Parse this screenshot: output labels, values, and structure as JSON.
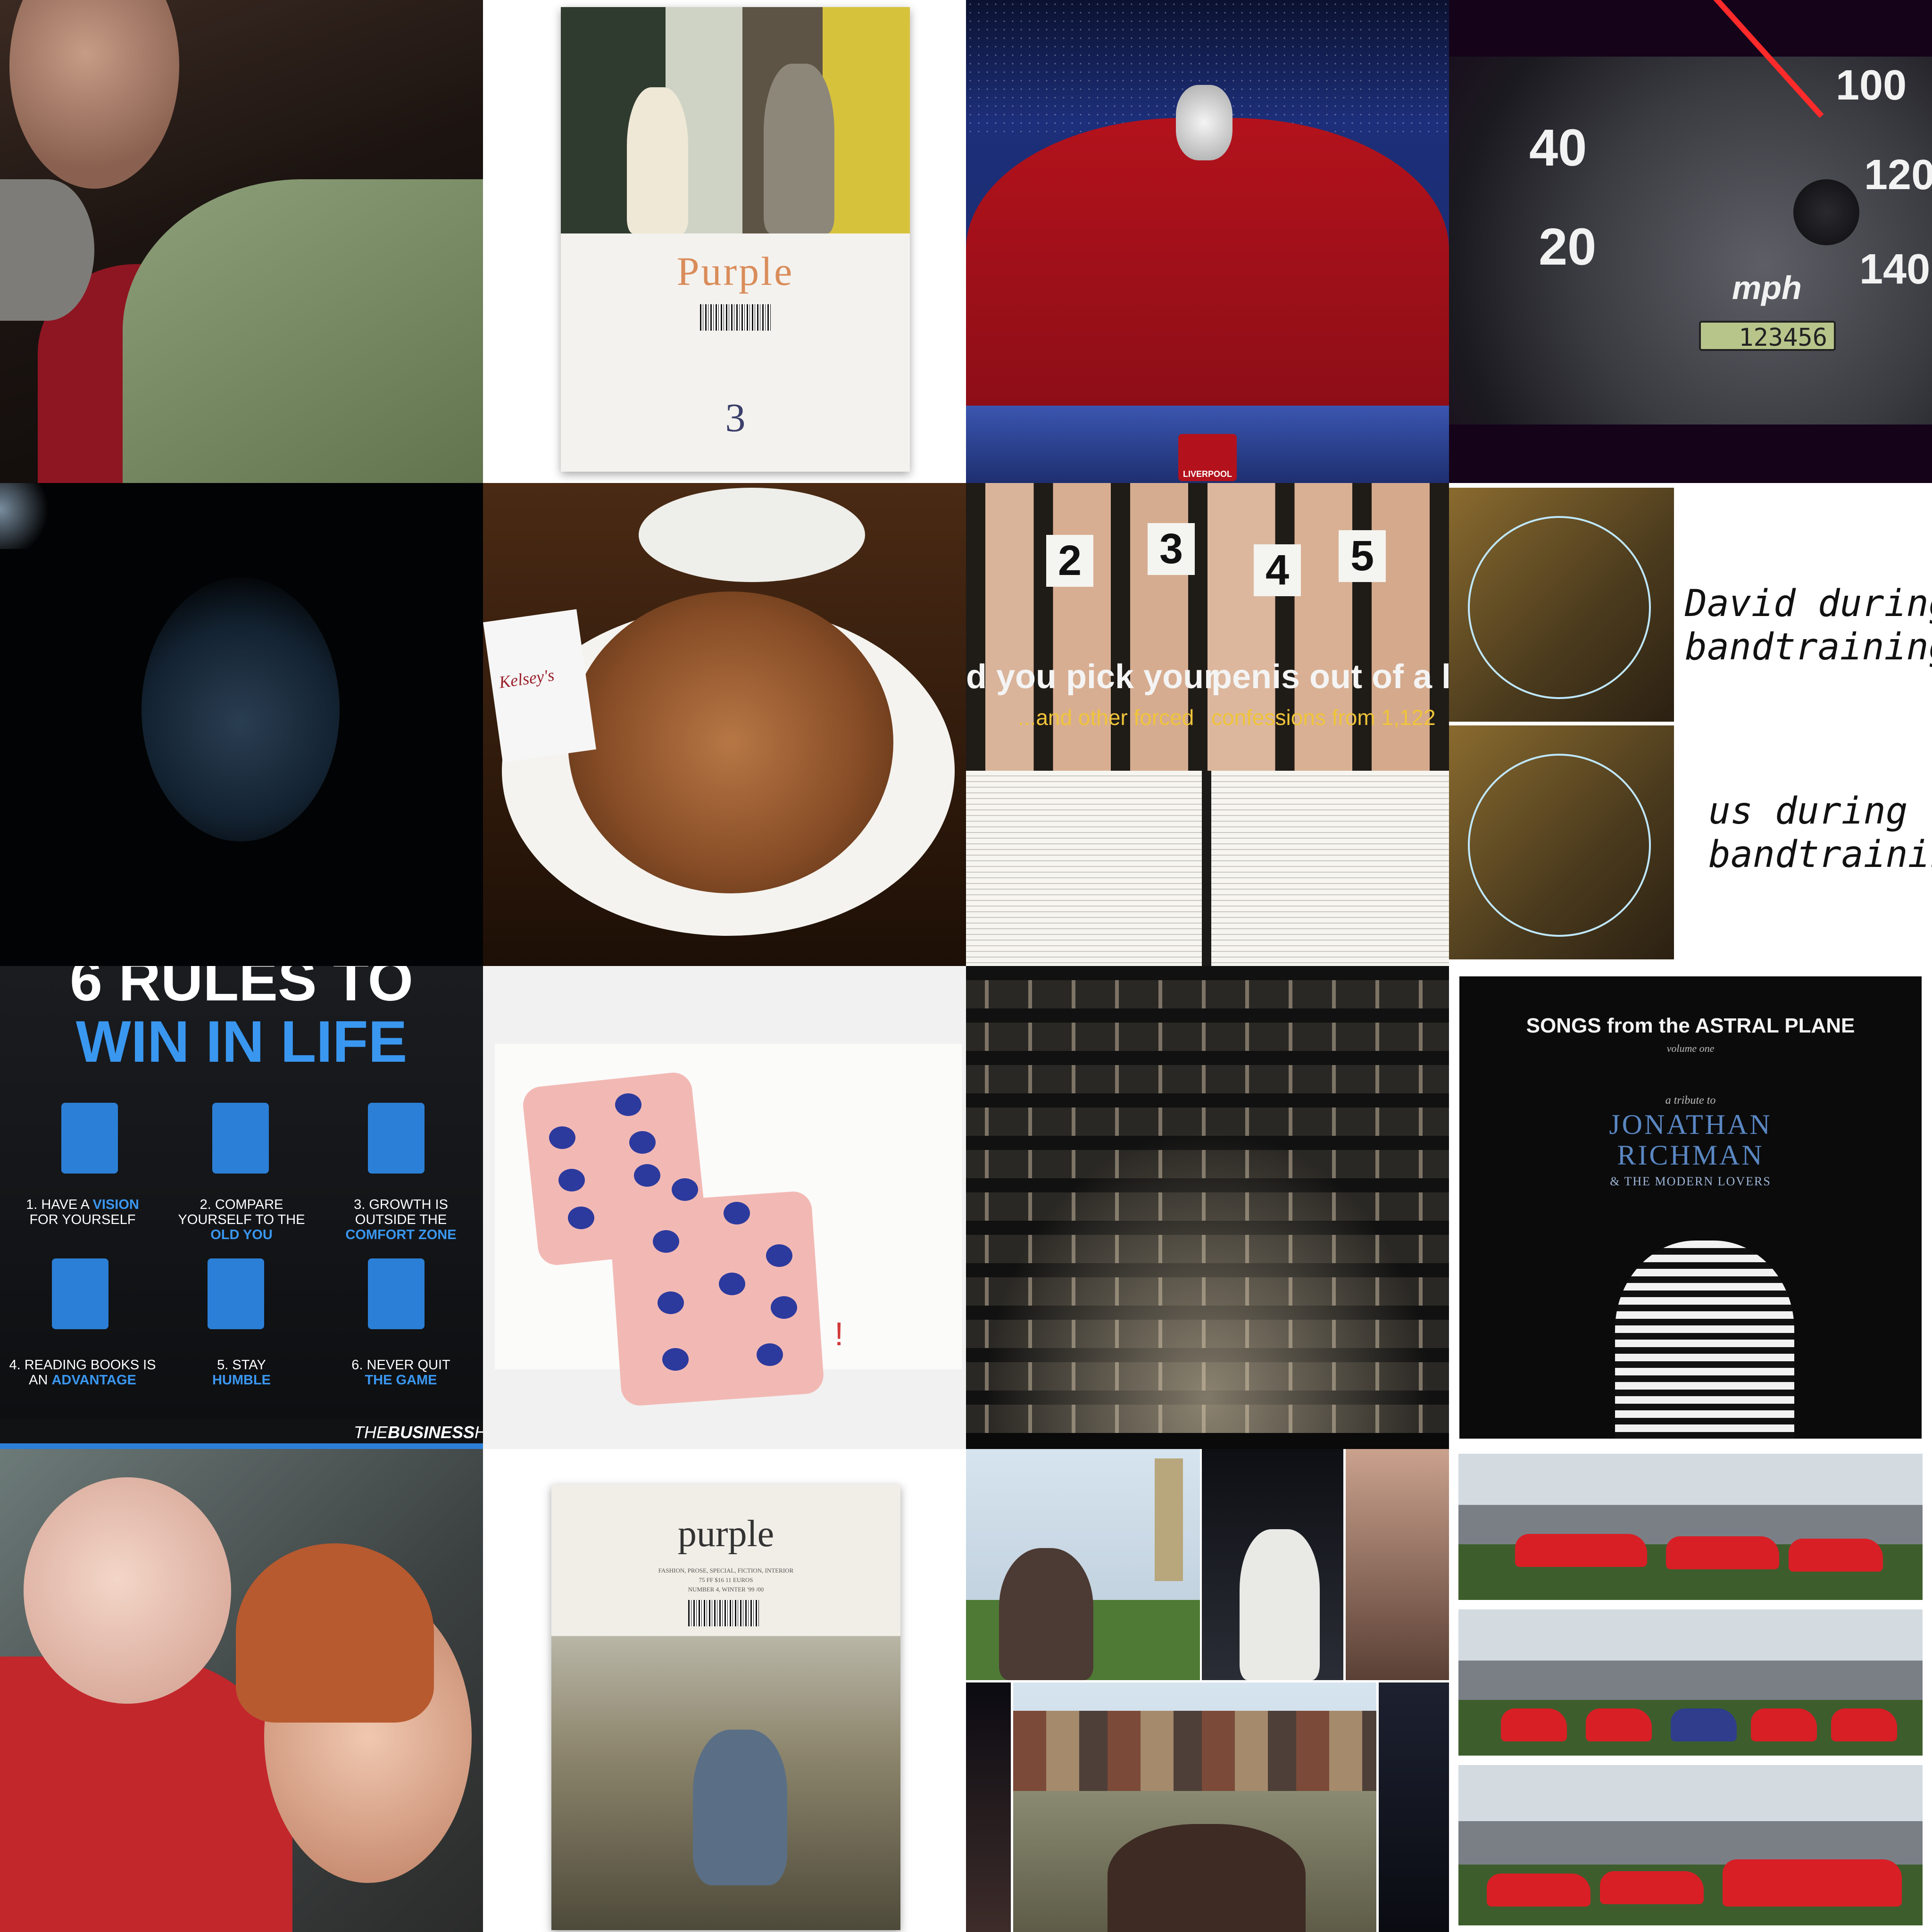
{
  "tiles": {
    "magazine_1": {
      "title": "Purple",
      "issue_number": "3"
    },
    "speedometer": {
      "speed_labels": [
        "20",
        "40",
        "100",
        "120",
        "140"
      ],
      "unit": "mph",
      "odometer": "123456"
    },
    "football": {
      "crest_text": "LIVERPOOL"
    },
    "wings": {
      "napkin_brand": "Kelsey's"
    },
    "confessions": {
      "numbers": [
        "2",
        "3",
        "4",
        "5"
      ],
      "headline_left": "d you pick your",
      "headline_right": "penis out of a li",
      "subhead_left": "...and other forced",
      "subhead_right": "confessions from 1,122"
    },
    "band": {
      "caption_1": [
        "David during",
        "bandtraining"
      ],
      "caption_2": [
        "us during",
        "bandtraining"
      ]
    },
    "rules": {
      "title_line_1": "6 RULES TO",
      "title_line_2": "WIN IN LIFE",
      "items": [
        {
          "num": "1.",
          "plain": "HAVE A",
          "highlight": "VISION",
          "rest": "FOR YOURSELF"
        },
        {
          "num": "2.",
          "plain": "COMPARE YOURSELF TO THE",
          "highlight": "OLD YOU",
          "rest": ""
        },
        {
          "num": "3.",
          "plain": "GROWTH IS OUTSIDE THE",
          "highlight": "COMFORT ZONE",
          "rest": ""
        },
        {
          "num": "4.",
          "plain": "READING BOOKS IS AN",
          "highlight": "ADVANTAGE",
          "rest": ""
        },
        {
          "num": "5.",
          "plain": "STAY",
          "highlight": "HUMBLE",
          "rest": ""
        },
        {
          "num": "6.",
          "plain": "NEVER QUIT",
          "highlight": "THE GAME",
          "rest": ""
        }
      ],
      "footer_plain": "THE",
      "footer_bold": "BUSINESS",
      "footer_tail": "HAC"
    },
    "dice": {
      "mark": "!"
    },
    "album": {
      "top_line": "SONGS from the ASTRAL PLANE",
      "volume": "volume one",
      "tribute": "a tribute to",
      "artist_1": "JONATHAN",
      "artist_2": "RICHMAN",
      "artist_3": "& THE MODERN LOVERS"
    },
    "magazine_2": {
      "title": "purple",
      "subtitle": "FASHION, PROSE, SPECIAL, FICTION, INTERIOR",
      "price": "75 FF $16 11 EUROS",
      "issue": "NUMBER 4, WINTER '99 /00"
    }
  },
  "colors": {
    "rules_blue": "#3a97f0",
    "dice_pink": "#f2b9b4",
    "dice_pip": "#2c3a9e",
    "car_red": "#d81f26",
    "jersey_red": "#b3121c"
  }
}
